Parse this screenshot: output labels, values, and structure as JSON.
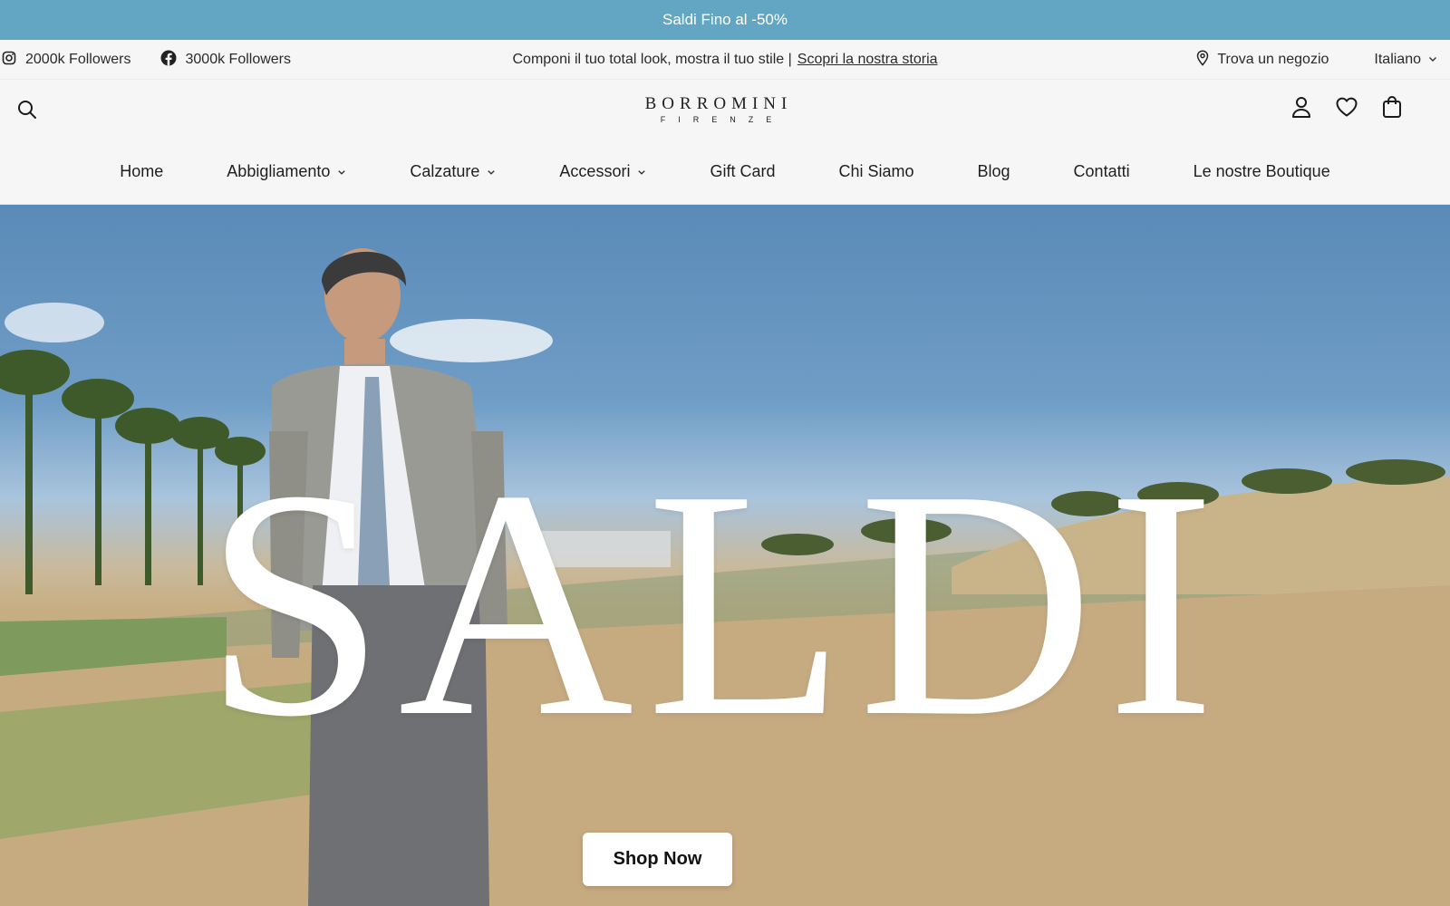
{
  "announcement": {
    "text": "Saldi Fino al -50%"
  },
  "utility_bar": {
    "instagram_followers": "2000k Followers",
    "facebook_followers": "3000k Followers",
    "tagline": "Componi il tuo total look, mostra il tuo stile |",
    "story_link": "Scopri la nostra storia",
    "store_locator": "Trova un negozio",
    "language": "Italiano"
  },
  "header": {
    "logo_main": "BORROMINI",
    "logo_sub": "FIRENZE",
    "icons": [
      "search-icon",
      "account-icon",
      "heart-icon",
      "bag-icon"
    ]
  },
  "nav": {
    "items": [
      {
        "label": "Home",
        "has_dropdown": false
      },
      {
        "label": "Abbigliamento",
        "has_dropdown": true
      },
      {
        "label": "Calzature",
        "has_dropdown": true
      },
      {
        "label": "Accessori",
        "has_dropdown": true
      },
      {
        "label": "Gift Card",
        "has_dropdown": false
      },
      {
        "label": "Chi Siamo",
        "has_dropdown": false
      },
      {
        "label": "Blog",
        "has_dropdown": false
      },
      {
        "label": "Contatti",
        "has_dropdown": false
      },
      {
        "label": "Le nostre Boutique",
        "has_dropdown": false
      }
    ]
  },
  "hero": {
    "headline": "SALDI",
    "cta_label": "Shop Now"
  },
  "colors": {
    "announcement_bg": "#62a6c4",
    "header_bg": "#f6f6f6",
    "cta_bg": "#ffffff"
  }
}
